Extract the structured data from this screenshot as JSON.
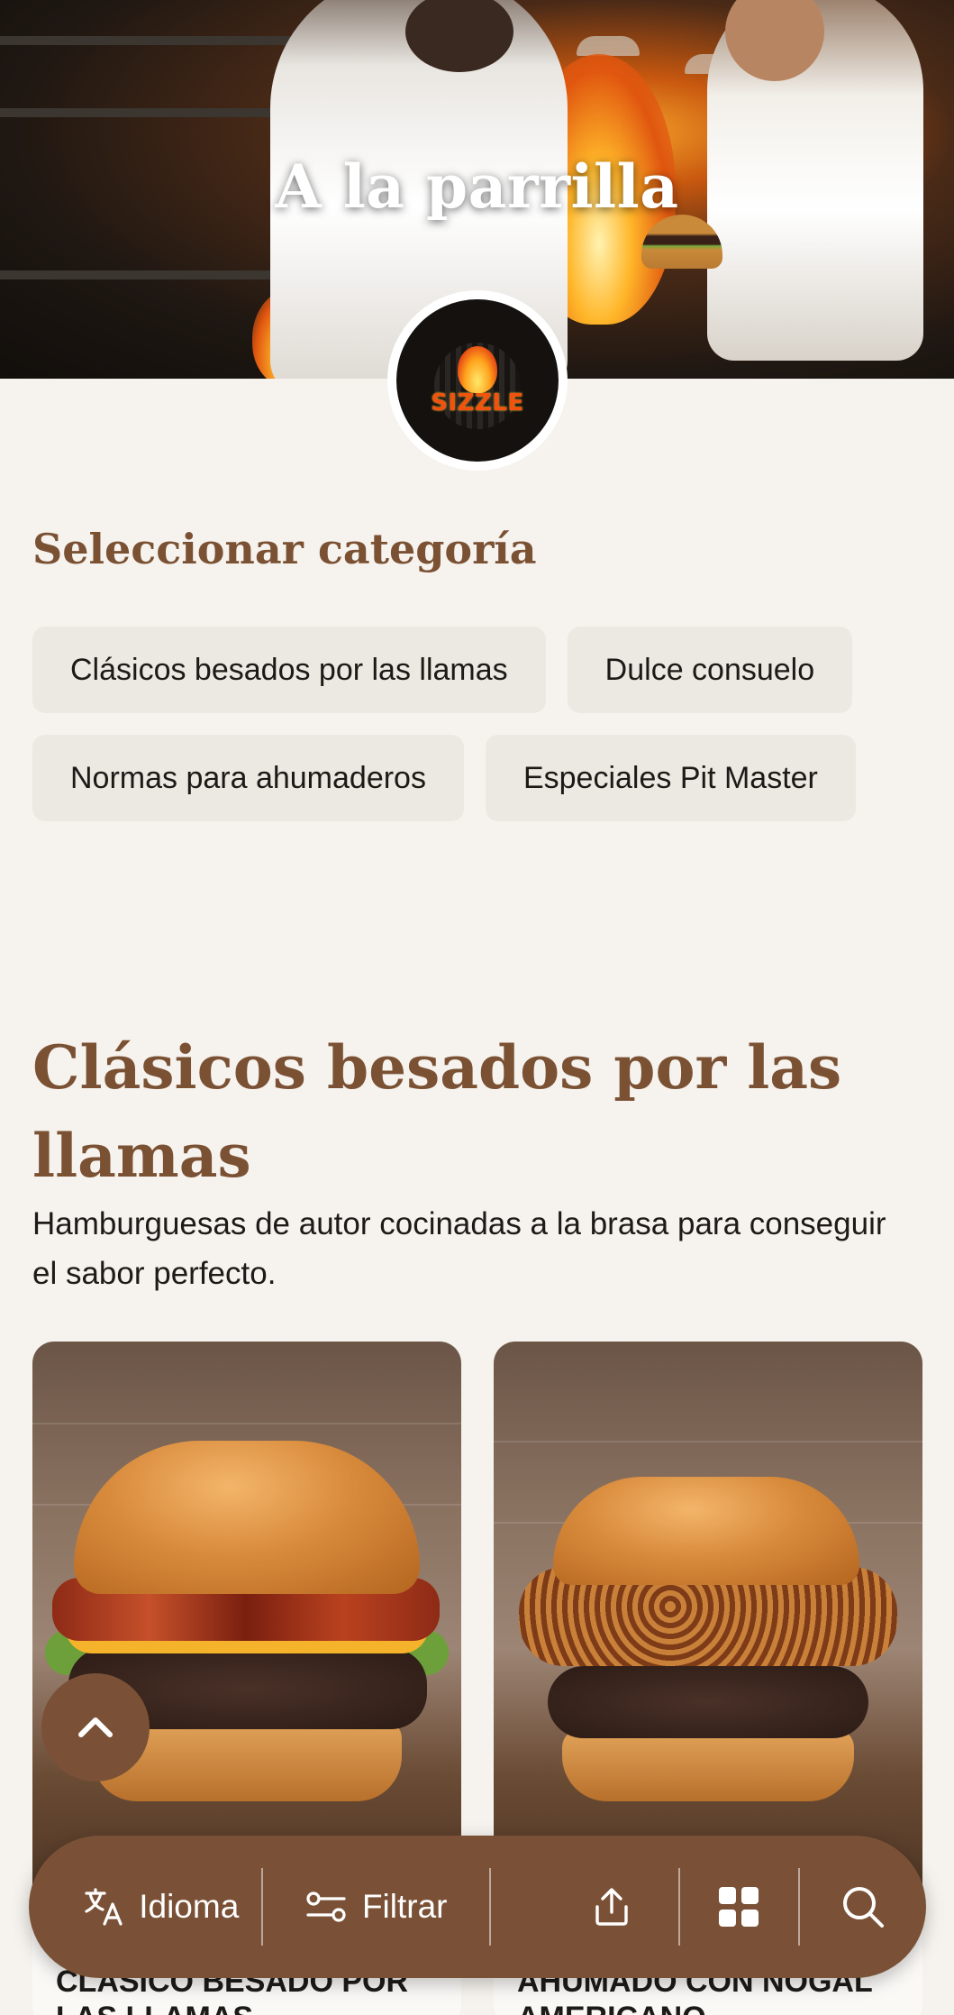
{
  "hero": {
    "title": "A la parrilla",
    "logo_text": "SIZZLE"
  },
  "category_selector": {
    "heading": "Seleccionar categoría",
    "categories": [
      "Clásicos besados por las llamas",
      "Dulce consuelo",
      "Normas para ahumaderos",
      "Especiales Pit Master"
    ]
  },
  "section": {
    "title": "Clásicos besados por las llamas",
    "description": "Hamburguesas de autor cocinadas a la brasa para conseguir el sabor perfecto."
  },
  "products": [
    {
      "name": "CLÁSICO BESADO POR LAS LLAMAS"
    },
    {
      "name": "AHUMADO CON NOGAL AMERICANO"
    }
  ],
  "bottom_bar": {
    "language_label": "Idioma",
    "filter_label": "Filtrar"
  },
  "icons": {
    "scroll_top": "chevron-up-icon",
    "language": "translate-icon",
    "filter": "filter-icon",
    "share": "share-icon",
    "grid": "grid-icon",
    "search": "search-icon"
  },
  "colors": {
    "accent": "#7a5136",
    "heading": "#7b5134",
    "background": "#f6f3ee",
    "chip_background": "#ece8e2"
  }
}
